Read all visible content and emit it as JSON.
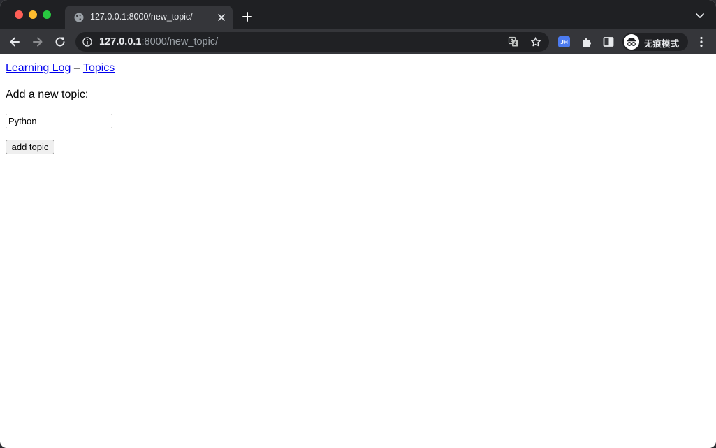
{
  "browser": {
    "tab": {
      "title": "127.0.0.1:8000/new_topic/",
      "favicon": "globe-icon"
    },
    "address_bar": {
      "host": "127.0.0.1",
      "path": ":8000/new_topic/"
    },
    "extension_badge": "JH",
    "profile_label": "无痕模式"
  },
  "page": {
    "nav": {
      "home_link": "Learning Log",
      "separator": "–",
      "topics_link": "Topics"
    },
    "heading": "Add a new topic:",
    "form": {
      "topic_value": "Python",
      "submit_label": "add topic"
    }
  },
  "colors": {
    "link": "#0000ee",
    "chrome_dark": "#35363a",
    "titlebar": "#1f2023"
  }
}
